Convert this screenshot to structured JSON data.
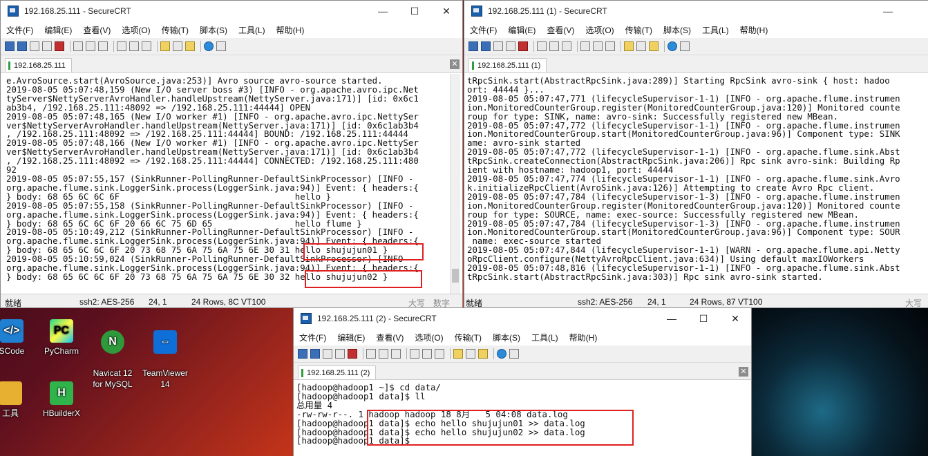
{
  "desktop": {
    "icons": [
      {
        "name": "vscode",
        "label": "SCode"
      },
      {
        "name": "pycharm",
        "label": "PyCharm"
      },
      {
        "name": "navicat",
        "label": "Navicat 12\nfor MySQL"
      },
      {
        "name": "teamviewer",
        "label": "TeamViewer\n14"
      },
      {
        "name": "tools",
        "label": "工具"
      },
      {
        "name": "hbuilderx",
        "label": "HBuilderX"
      }
    ]
  },
  "windows": [
    {
      "title": "192.168.25.111 - SecureCRT",
      "tab": "192.168.25.111",
      "menu": [
        "文件(F)",
        "编辑(E)",
        "查看(V)",
        "选项(O)",
        "传输(T)",
        "脚本(S)",
        "工具(L)",
        "帮助(H)"
      ],
      "lines": [
        "e.AvroSource.start(AvroSource.java:253)] Avro source avro-source started.",
        "2019-08-05 05:07:48,159 (New I/O server boss #3) [INFO - org.apache.avro.ipc.Net",
        "tyServer$NettyServerAvroHandler.handleUpstream(NettyServer.java:171)] [id: 0x6c1",
        "ab3b4, /192.168.25.111:48092 => /192.168.25.111:44444] OPEN",
        "2019-08-05 05:07:48,165 (New I/O worker #1) [INFO - org.apache.avro.ipc.NettySer",
        "ver$NettyServerAvroHandler.handleUpstream(NettyServer.java:171)] [id: 0x6c1ab3b4",
        ", /192.168.25.111:48092 => /192.168.25.111:44444] BOUND: /192.168.25.111:44444",
        "2019-08-05 05:07:48,166 (New I/O worker #1) [INFO - org.apache.avro.ipc.NettySer",
        "ver$NettyServerAvroHandler.handleUpstream(NettyServer.java:171)] [id: 0x6c1ab3b4",
        ", /192.168.25.111:48092 => /192.168.25.111:44444] CONNECTED: /192.168.25.111:480",
        "92",
        "2019-08-05 05:07:55,157 (SinkRunner-PollingRunner-DefaultSinkProcessor) [INFO -",
        "org.apache.flume.sink.LoggerSink.process(LoggerSink.java:94)] Event: { headers:{",
        "} body: 68 65 6C 6C 6F                                  hello }",
        "2019-08-05 05:07:55,158 (SinkRunner-PollingRunner-DefaultSinkProcessor) [INFO -",
        "org.apache.flume.sink.LoggerSink.process(LoggerSink.java:94)] Event: { headers:{",
        "} body: 68 65 6C 6C 6F 20 66 6C 75 6D 65                hello flume }",
        "2019-08-05 05:10:49,212 (SinkRunner-PollingRunner-DefaultSinkProcessor) [INFO -",
        "org.apache.flume.sink.LoggerSink.process(LoggerSink.java:94)] Event: { headers:{",
        "} body: 68 65 6C 6C 6F 20 73 68 75 6A 75 6A 75 6E 30 31 hello shujujun01 }",
        "2019-08-05 05:10:59,024 (SinkRunner-PollingRunner-DefaultSinkProcessor) [INFO -",
        "org.apache.flume.sink.LoggerSink.process(LoggerSink.java:94)] Event: { headers:{",
        "} body: 68 65 6C 6C 6F 20 73 68 75 6A 75 6A 75 6E 30 32 hello shujujun02 }"
      ],
      "status": {
        "ready": "就绪",
        "cipher": "ssh2: AES-256",
        "pos": "24,  1",
        "size": "24 Rows, 8C VT100",
        "caps": "大写",
        "num": "数字"
      }
    },
    {
      "title": "192.168.25.111 (1) - SecureCRT",
      "tab": "192.168.25.111 (1)",
      "menu": [
        "文件(F)",
        "编辑(E)",
        "查看(V)",
        "选项(O)",
        "传输(T)",
        "脚本(S)",
        "工具(L)",
        "帮助(H)"
      ],
      "lines": [
        "tRpcSink.start(AbstractRpcSink.java:289)] Starting RpcSink avro-sink { host: hadoo",
        "ort: 44444 }...",
        "2019-08-05 05:07:47,771 (lifecycleSupervisor-1-1) [INFO - org.apache.flume.instrumen",
        "ion.MonitoredCounterGroup.register(MonitoredCounterGroup.java:120)] Monitored counte",
        "roup for type: SINK, name: avro-sink: Successfully registered new MBean.",
        "2019-08-05 05:07:47,772 (lifecycleSupervisor-1-1) [INFO - org.apache.flume.instrumen",
        "ion.MonitoredCounterGroup.start(MonitoredCounterGroup.java:96)] Component type: SINK",
        "ame: avro-sink started",
        "2019-08-05 05:07:47,772 (lifecycleSupervisor-1-1) [INFO - org.apache.flume.sink.Abst",
        "tRpcSink.createConnection(AbstractRpcSink.java:206)] Rpc sink avro-sink: Building Rp",
        "ient with hostname: hadoop1, port: 44444",
        "2019-08-05 05:07:47,774 (lifecycleSupervisor-1-1) [INFO - org.apache.flume.sink.Avro",
        "k.initializeRpcClient(AvroSink.java:126)] Attempting to create Avro Rpc client.",
        "2019-08-05 05:07:47,784 (lifecycleSupervisor-1-3) [INFO - org.apache.flume.instrumen",
        "ion.MonitoredCounterGroup.register(MonitoredCounterGroup.java:120)] Monitored counte",
        "roup for type: SOURCE, name: exec-source: Successfully registered new MBean.",
        "2019-08-05 05:07:47,784 (lifecycleSupervisor-1-3) [INFO - org.apache.flume.instrumen",
        "ion.MonitoredCounterGroup.start(MonitoredCounterGroup.java:96)] Component type: SOUR",
        " name: exec-source started",
        "2019-08-05 05:07:47,844 (lifecycleSupervisor-1-1) [WARN - org.apache.flume.api.Netty",
        "oRpcClient.configure(NettyAvroRpcClient.java:634)] Using default maxIOWorkers",
        "2019-08-05 05:07:48,816 (lifecycleSupervisor-1-1) [INFO - org.apache.flume.sink.Abst",
        "tRpcSink.start(AbstractRpcSink.java:303)] Rpc sink avro-sink started."
      ],
      "status": {
        "ready": "就绪",
        "cipher": "ssh2: AES-256",
        "pos": "24,  1",
        "size": "24 Rows, 87 VT100",
        "caps": "大写"
      }
    },
    {
      "title": "192.168.25.111 (2) - SecureCRT",
      "tab": "192.168.25.111 (2)",
      "menu": [
        "文件(F)",
        "编辑(E)",
        "查看(V)",
        "选项(O)",
        "传输(T)",
        "脚本(S)",
        "工具(L)",
        "帮助(H)"
      ],
      "lines": [
        "[hadoop@hadoop1 ~]$ cd data/",
        "[hadoop@hadoop1 data]$ ll",
        "总用量 4",
        "-rw-rw-r--. 1 hadoop hadoop 18 8月   5 04:08 data.log",
        "[hadoop@hadoop1 data]$ echo hello shujujun01 >> data.log",
        "[hadoop@hadoop1 data]$ echo hello shujujun02 >> data.log",
        "[hadoop@hadoop1 data]$"
      ]
    }
  ]
}
